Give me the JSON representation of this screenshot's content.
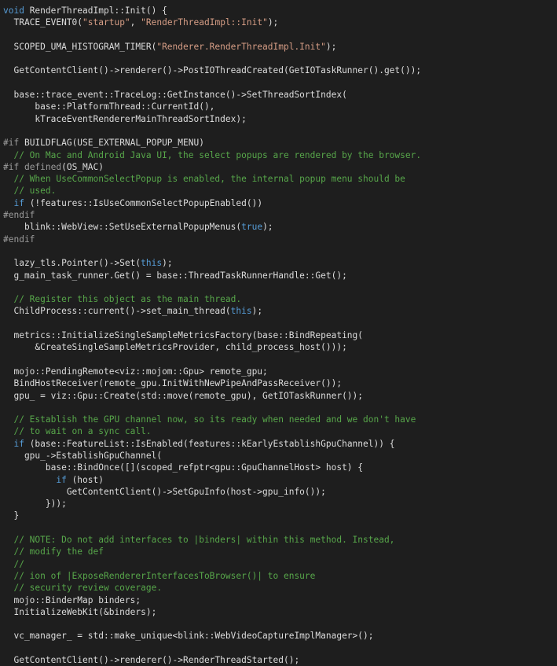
{
  "editor": {
    "colors": {
      "background": "#1e1e1e",
      "keyword": "#569cd6",
      "string": "#d69d85",
      "comment": "#57a64a",
      "preprocessor": "#9b9b9b",
      "text": "#dcdcdc"
    },
    "lines": [
      [
        {
          "t": "void",
          "c": "keyword"
        },
        {
          "t": " RenderThreadImpl::Init() {",
          "c": "plain"
        }
      ],
      [
        {
          "t": "  TRACE_EVENT0(",
          "c": "plain"
        },
        {
          "t": "\"startup\"",
          "c": "string"
        },
        {
          "t": ", ",
          "c": "plain"
        },
        {
          "t": "\"RenderThreadImpl::Init\"",
          "c": "string"
        },
        {
          "t": ");",
          "c": "plain"
        }
      ],
      [],
      [
        {
          "t": "  SCOPED_UMA_HISTOGRAM_TIMER(",
          "c": "plain"
        },
        {
          "t": "\"Renderer.RenderThreadImpl.Init\"",
          "c": "string"
        },
        {
          "t": ");",
          "c": "plain"
        }
      ],
      [],
      [
        {
          "t": "  GetContentClient()->renderer()->PostIOThreadCreated(GetIOTaskRunner().get());",
          "c": "plain"
        }
      ],
      [],
      [
        {
          "t": "  base::trace_event::TraceLog::GetInstance()->SetThreadSortIndex(",
          "c": "plain"
        }
      ],
      [
        {
          "t": "      base::PlatformThread::CurrentId(),",
          "c": "plain"
        }
      ],
      [
        {
          "t": "      kTraceEventRendererMainThreadSortIndex);",
          "c": "plain"
        }
      ],
      [],
      [
        {
          "t": "#if",
          "c": "preproc"
        },
        {
          "t": " BUILDFLAG(USE_EXTERNAL_POPUP_MENU)",
          "c": "plain"
        }
      ],
      [
        {
          "t": "  // On Mac and Android Java UI, the select popups are rendered by the browser.",
          "c": "comment"
        }
      ],
      [
        {
          "t": "#if",
          "c": "preproc"
        },
        {
          "t": " defined",
          "c": "preproc"
        },
        {
          "t": "(OS_MAC)",
          "c": "plain"
        }
      ],
      [
        {
          "t": "  // When UseCommonSelectPopup is enabled, the internal popup menu should be",
          "c": "comment"
        }
      ],
      [
        {
          "t": "  // used.",
          "c": "comment"
        }
      ],
      [
        {
          "t": "  if",
          "c": "keyword"
        },
        {
          "t": " (!features::IsUseCommonSelectPopupEnabled())",
          "c": "plain"
        }
      ],
      [
        {
          "t": "#endif",
          "c": "preproc"
        }
      ],
      [
        {
          "t": "    blink::WebView::SetUseExternalPopupMenus(",
          "c": "plain"
        },
        {
          "t": "true",
          "c": "keyword"
        },
        {
          "t": ");",
          "c": "plain"
        }
      ],
      [
        {
          "t": "#endif",
          "c": "preproc"
        }
      ],
      [],
      [
        {
          "t": "  lazy_tls.Pointer()->Set(",
          "c": "plain"
        },
        {
          "t": "this",
          "c": "keyword"
        },
        {
          "t": ");",
          "c": "plain"
        }
      ],
      [
        {
          "t": "  g_main_task_runner.Get() = base::ThreadTaskRunnerHandle::Get();",
          "c": "plain"
        }
      ],
      [],
      [
        {
          "t": "  // Register this object as the main thread.",
          "c": "comment"
        }
      ],
      [
        {
          "t": "  ChildProcess::current()->set_main_thread(",
          "c": "plain"
        },
        {
          "t": "this",
          "c": "keyword"
        },
        {
          "t": ");",
          "c": "plain"
        }
      ],
      [],
      [
        {
          "t": "  metrics::InitializeSingleSampleMetricsFactory(base::BindRepeating(",
          "c": "plain"
        }
      ],
      [
        {
          "t": "      &CreateSingleSampleMetricsProvider, child_process_host()));",
          "c": "plain"
        }
      ],
      [],
      [
        {
          "t": "  mojo::PendingRemote<viz::mojom::Gpu> remote_gpu;",
          "c": "plain"
        }
      ],
      [
        {
          "t": "  BindHostReceiver(remote_gpu.InitWithNewPipeAndPassReceiver());",
          "c": "plain"
        }
      ],
      [
        {
          "t": "  gpu_ = viz::Gpu::Create(std::move(remote_gpu), GetIOTaskRunner());",
          "c": "plain"
        }
      ],
      [],
      [
        {
          "t": "  // Establish the GPU channel now, so its ready when needed and we don't have",
          "c": "comment"
        }
      ],
      [
        {
          "t": "  // to wait on a sync call.",
          "c": "comment"
        }
      ],
      [
        {
          "t": "  if",
          "c": "keyword"
        },
        {
          "t": " (base::FeatureList::IsEnabled(features::kEarlyEstablishGpuChannel)) {",
          "c": "plain"
        }
      ],
      [
        {
          "t": "    gpu_->EstablishGpuChannel(",
          "c": "plain"
        }
      ],
      [
        {
          "t": "        base::BindOnce([](scoped_refptr<gpu::GpuChannelHost> host) {",
          "c": "plain"
        }
      ],
      [
        {
          "t": "          if",
          "c": "keyword"
        },
        {
          "t": " (host)",
          "c": "plain"
        }
      ],
      [
        {
          "t": "            GetContentClient()->SetGpuInfo(host->gpu_info());",
          "c": "plain"
        }
      ],
      [
        {
          "t": "        }));",
          "c": "plain"
        }
      ],
      [
        {
          "t": "  }",
          "c": "plain"
        }
      ],
      [],
      [
        {
          "t": "  // NOTE: Do not add interfaces to |binders| within this method. Instead,",
          "c": "comment"
        }
      ],
      [
        {
          "t": "  // modify the def",
          "c": "comment"
        }
      ],
      [
        {
          "t": "  //",
          "c": "comment"
        }
      ],
      [
        {
          "t": "  // ion of |ExposeRendererInterfacesToBrowser()| to ensure",
          "c": "comment"
        }
      ],
      [
        {
          "t": "  // security review coverage.",
          "c": "comment"
        }
      ],
      [
        {
          "t": "  mojo::BinderMap binders;",
          "c": "plain"
        }
      ],
      [
        {
          "t": "  InitializeWebKit(&binders);",
          "c": "plain"
        }
      ],
      [],
      [
        {
          "t": "  vc_manager_ = std::make_unique<blink::WebVideoCaptureImplManager>();",
          "c": "plain"
        }
      ],
      [],
      [
        {
          "t": "  GetContentClient()->renderer()->RenderThreadStarted();",
          "c": "plain"
        }
      ]
    ]
  }
}
